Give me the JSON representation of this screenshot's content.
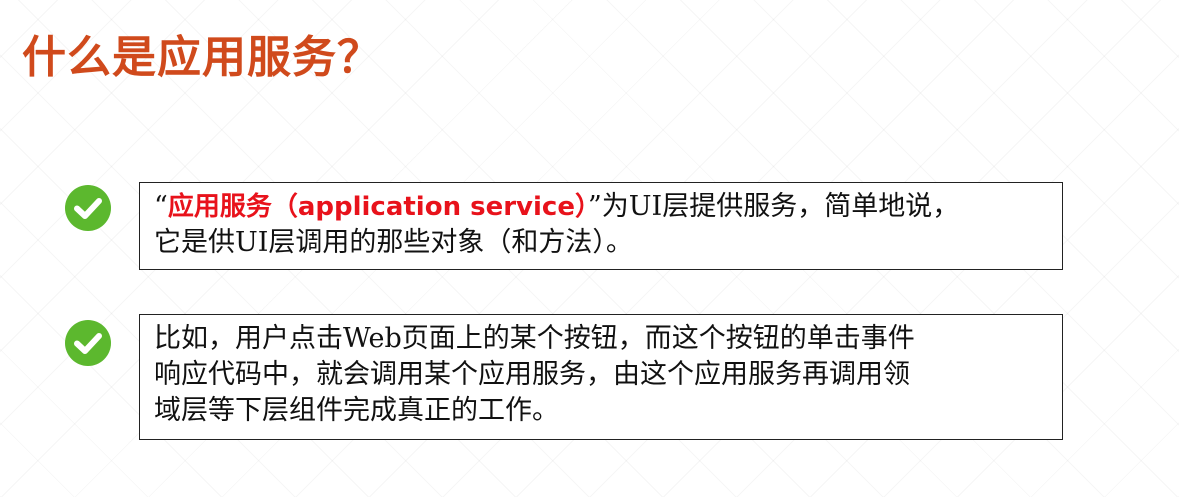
{
  "title": "什么是应用服务？",
  "colors": {
    "title": "#d04a1c",
    "highlight": "#e8121b",
    "check": "#5cb82e"
  },
  "items": [
    {
      "icon": "check-circle-icon",
      "open_quote": "“",
      "highlight": "应用服务（application service）",
      "line1_rest": "”为UI层提供服务，简单地说，",
      "line2": "它是供UI层调用的那些对象（和方法）。"
    },
    {
      "icon": "check-circle-icon",
      "line1": "比如，用户点击Web页面上的某个按钮，而这个按钮的单击事件",
      "line2": "响应代码中，就会调用某个应用服务，由这个应用服务再调用领",
      "line3": "域层等下层组件完成真正的工作。"
    }
  ]
}
